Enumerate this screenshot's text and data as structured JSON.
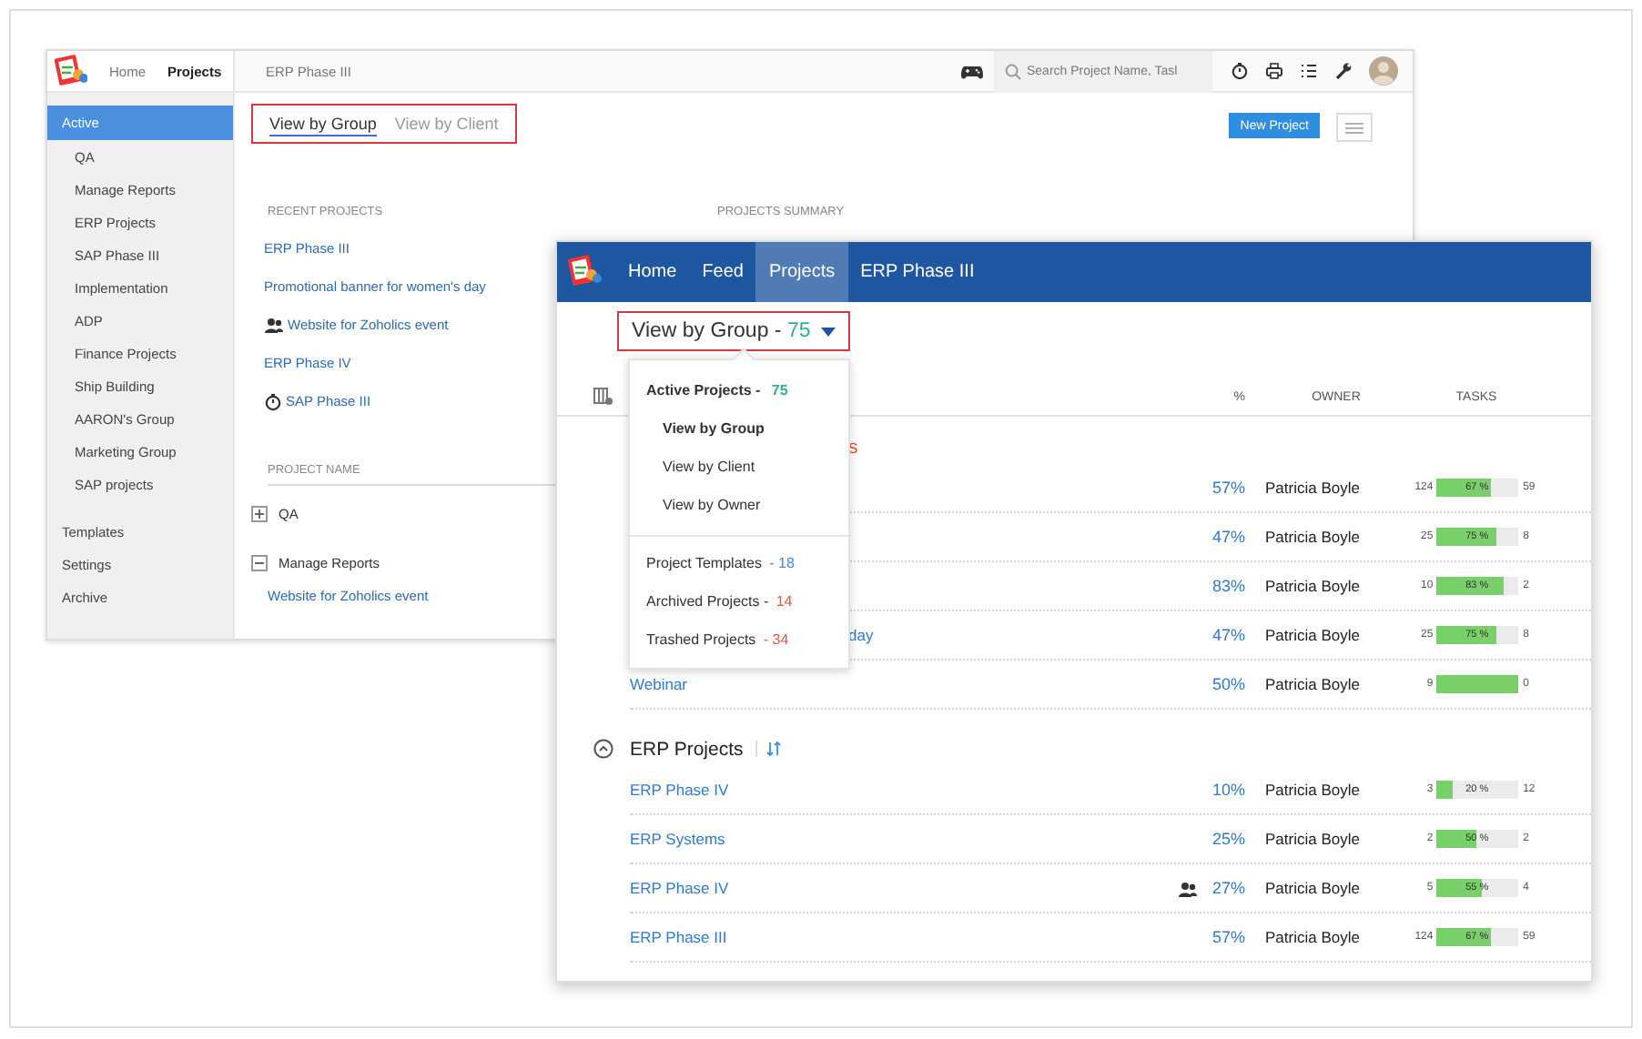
{
  "back_window": {
    "nav": [
      {
        "label": "Home",
        "selected": false
      },
      {
        "label": "Projects",
        "selected": true
      }
    ],
    "breadcrumb": "ERP Phase III",
    "search": {
      "placeholder": "Search Project Name, Tasl"
    },
    "sidebar": {
      "items": [
        {
          "label": "Active",
          "selected": true,
          "children": [
            {
              "label": "QA",
              "selected": false
            },
            {
              "label": "Manage Reports",
              "selected": false
            },
            {
              "label": "ERP Projects",
              "selected": false
            },
            {
              "label": "SAP Phase III",
              "selected": false
            },
            {
              "label": "Implementation",
              "selected": false
            },
            {
              "label": "ADP",
              "selected": false
            },
            {
              "label": "Finance Projects",
              "selected": false
            },
            {
              "label": "Ship Building",
              "selected": false
            },
            {
              "label": "AARON's Group",
              "selected": false
            },
            {
              "label": "Marketing Group",
              "selected": false
            },
            {
              "label": "SAP projects",
              "selected": false
            }
          ]
        },
        {
          "label": "Templates",
          "selected": false
        },
        {
          "label": "Settings",
          "selected": false
        },
        {
          "label": "Archive",
          "selected": false
        }
      ]
    },
    "view_tabs": [
      {
        "label": "View by Group",
        "selected": true
      },
      {
        "label": "View by Client",
        "selected": false
      }
    ],
    "new_project_button": "New Project",
    "recent_projects": {
      "title": "RECENT PROJECTS",
      "items": [
        {
          "name": "ERP Phase III",
          "kind": "plain"
        },
        {
          "name": "Promotional banner for women's day",
          "kind": "plain"
        },
        {
          "name": "Website for Zoholics event",
          "kind": "shared"
        },
        {
          "name": "ERP Phase IV",
          "kind": "plain"
        },
        {
          "name": "SAP Phase III",
          "kind": "scheduled"
        }
      ]
    },
    "projects_summary_title": "PROJECTS SUMMARY",
    "project_table": {
      "column": "PROJECT NAME",
      "groups": [
        {
          "name": "QA",
          "expanded": false
        },
        {
          "name": "Manage Reports",
          "expanded": true,
          "children": [
            {
              "name": "Website for Zoholics event"
            }
          ]
        }
      ]
    }
  },
  "front_window": {
    "nav": [
      {
        "label": "Home",
        "selected": false
      },
      {
        "label": "Feed",
        "selected": false
      },
      {
        "label": "Projects",
        "selected": true
      },
      {
        "label": "ERP Phase III",
        "selected": false
      }
    ],
    "view_selector": {
      "label": "View by Group - ",
      "count": "75"
    },
    "menu": {
      "items": [
        {
          "kind": "header",
          "label": "Active Projects - ",
          "count": "75",
          "color": "#2bb48b"
        },
        {
          "kind": "option",
          "label": "View by Group",
          "selected": true
        },
        {
          "kind": "option",
          "label": "View by Client",
          "selected": false
        },
        {
          "kind": "option",
          "label": "View by Owner",
          "selected": false
        },
        {
          "kind": "summary",
          "label": "Project Templates ",
          "count": "- 18",
          "color": "#3d8fe0"
        },
        {
          "kind": "summary",
          "label": "Archived Projects - ",
          "count": "14",
          "color": "#e8533b"
        },
        {
          "kind": "summary",
          "label": "Trashed Projects ",
          "count": "- 34",
          "color": "#e8533b"
        }
      ]
    },
    "table": {
      "columns": [
        "%",
        "OWNER",
        "TASKS"
      ],
      "groups": [
        {
          "title": "s",
          "cut": true,
          "collapse_icon": false,
          "sort_icon": false,
          "rows": [
            {
              "percent": "57%",
              "owner": "Patricia Boyle",
              "open": "124",
              "level": 0.67,
              "bar_label": "67 %",
              "closed": "59"
            },
            {
              "percent": "47%",
              "owner": "Patricia Boyle",
              "open": "25",
              "level": 0.75,
              "bar_label": "75 %",
              "closed": "8"
            },
            {
              "percent": "83%",
              "owner": "Patricia Boyle",
              "open": "10",
              "level": 0.83,
              "bar_label": "83 %",
              "closed": "2"
            },
            {
              "name": "day",
              "cut": true,
              "percent": "47%",
              "owner": "Patricia Boyle",
              "open": "25",
              "level": 0.75,
              "bar_label": "75 %",
              "closed": "8"
            },
            {
              "name": "Webinar",
              "percent": "50%",
              "owner": "Patricia Boyle",
              "open": "9",
              "level": 1,
              "closed": "0"
            }
          ]
        },
        {
          "title": "ERP Projects",
          "collapse_icon": true,
          "sort_icon": true,
          "rows": [
            {
              "name": "ERP Phase IV",
              "percent": "10%",
              "owner": "Patricia Boyle",
              "open": "3",
              "level": 0.2,
              "bar_label": "20 %",
              "closed": "12"
            },
            {
              "name": "ERP Systems",
              "percent": "25%",
              "owner": "Patricia Boyle",
              "open": "2",
              "level": 0.5,
              "bar_label": "50 %",
              "closed": "2"
            },
            {
              "name": "ERP Phase IV",
              "people_icon": true,
              "percent": "27%",
              "owner": "Patricia Boyle",
              "open": "5",
              "level": 0.55,
              "bar_label": "55 %",
              "closed": "4"
            },
            {
              "name": "ERP Phase III",
              "percent": "57%",
              "owner": "Patricia Boyle",
              "open": "124",
              "level": 0.67,
              "bar_label": "67 %",
              "closed": "59"
            }
          ]
        }
      ]
    }
  }
}
